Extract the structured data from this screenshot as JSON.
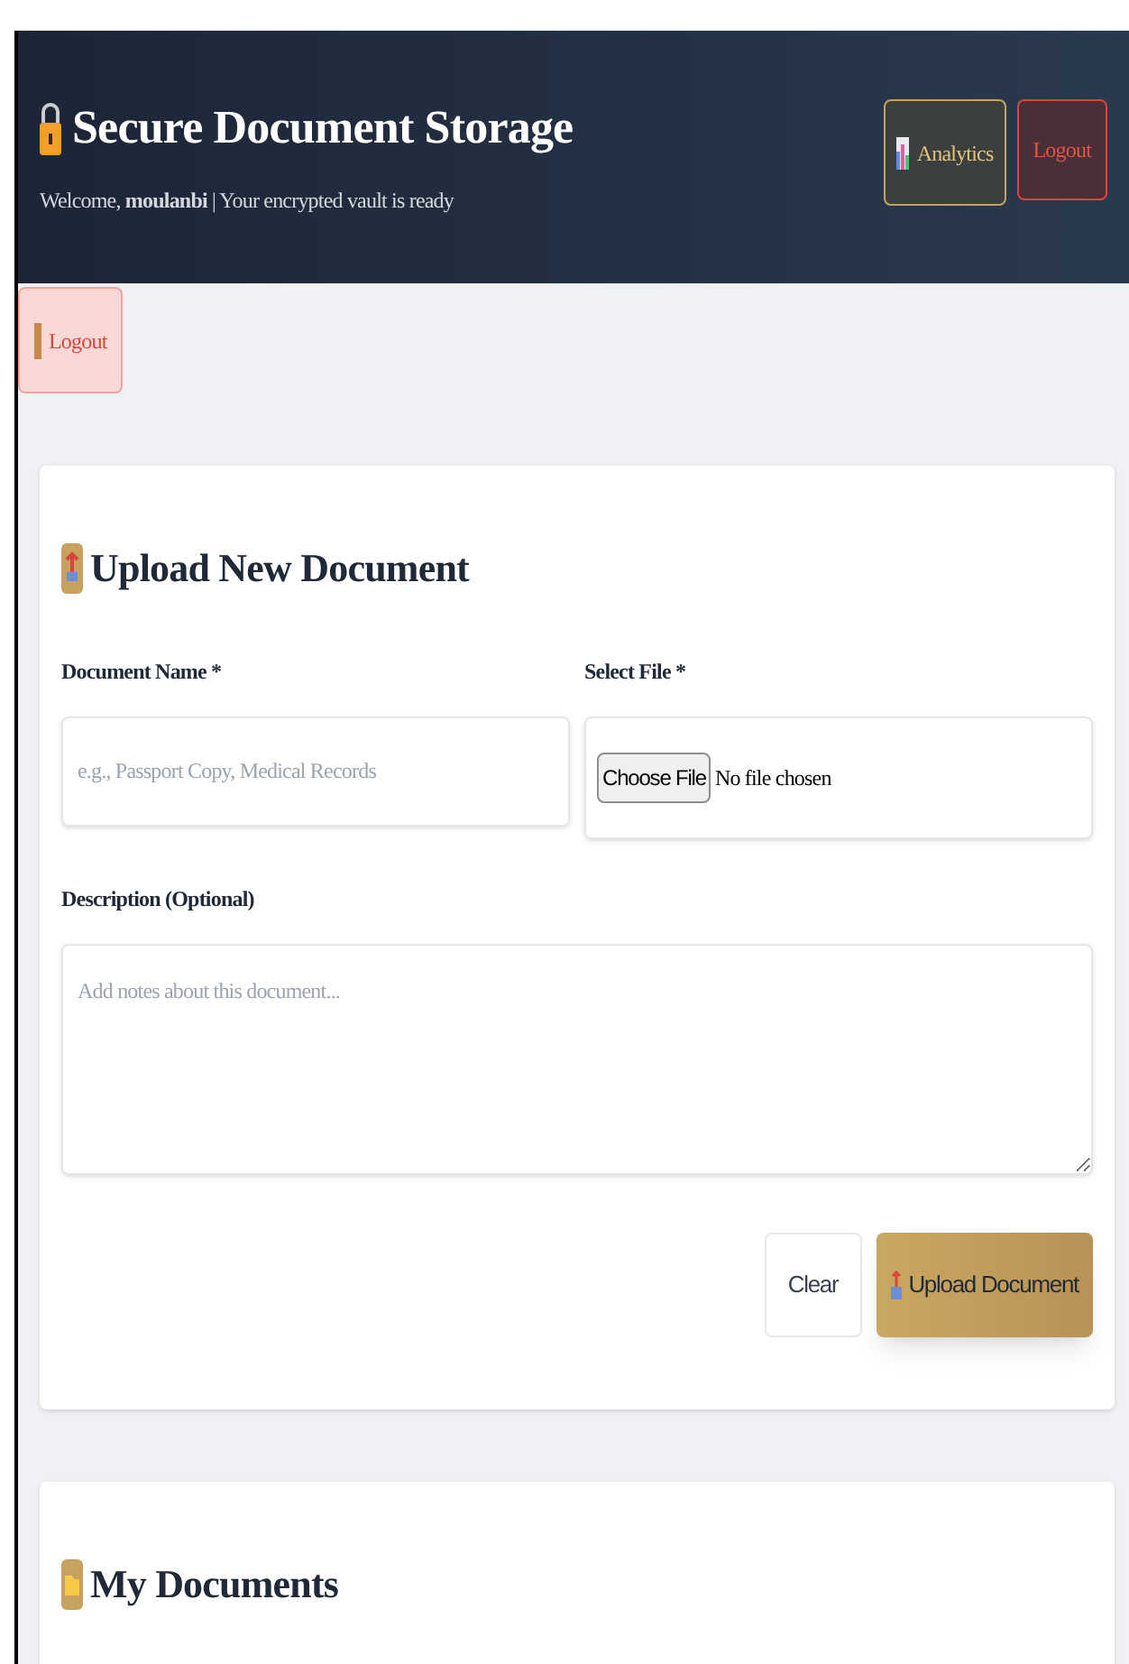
{
  "header": {
    "title": "Secure Document Storage",
    "welcome": "Welcome, **moulanbi** | Your encrypted vault is ready",
    "buttons": [
      {
        "kind": "analytics",
        "label": "Analytics"
      },
      {
        "kind": "logout",
        "label": "Logout"
      }
    ]
  },
  "floating_logout": {
    "label": "Logout"
  },
  "upload_card": {
    "title": "Upload New Document",
    "fields": [
      {
        "kind": "text",
        "label": "Document Name *",
        "placeholder": "e.g., Passport Copy, Medical Records"
      },
      {
        "kind": "file",
        "label": "Select File *",
        "button": "Choose File",
        "status": "No file chosen"
      },
      {
        "kind": "textarea",
        "label": "Description (Optional)",
        "placeholder": "Add notes about this document..."
      }
    ],
    "buttons": [
      {
        "kind": "secondary",
        "label": "Clear"
      },
      {
        "kind": "primary",
        "label": "Upload Document"
      }
    ]
  },
  "documents_card": {
    "title": "My Documents"
  }
}
